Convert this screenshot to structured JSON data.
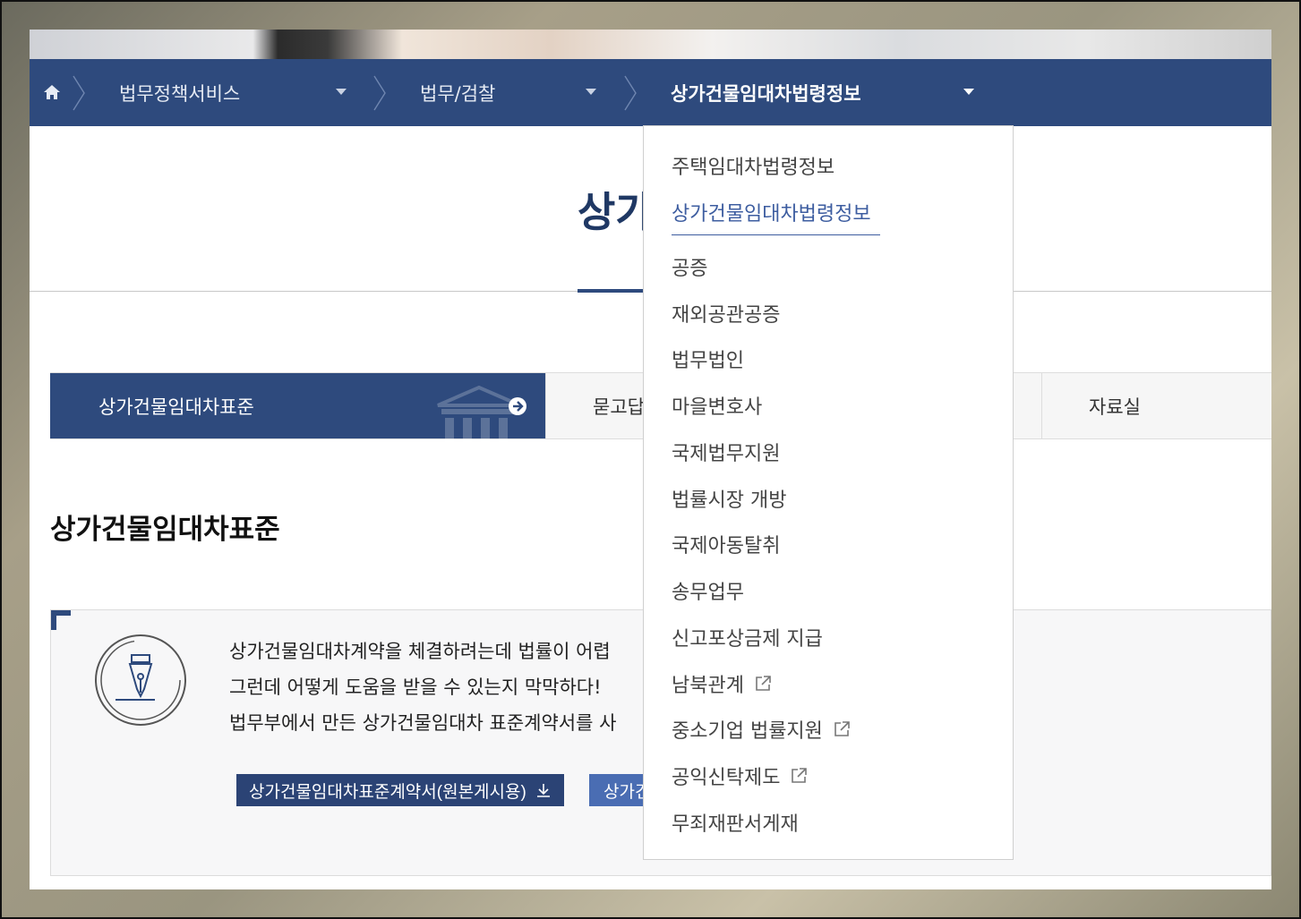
{
  "breadcrumb": {
    "home_icon": "home-icon",
    "level1": "법무정책서비스",
    "level2": "법무/검찰",
    "level3": "상가건물임대차법령정보"
  },
  "page": {
    "title": "상가"
  },
  "tabs": [
    {
      "label": "상가건물임대차표준",
      "active": true
    },
    {
      "label": "묻고답",
      "active": false
    },
    {
      "label": "",
      "active": false
    },
    {
      "label": "자료실",
      "active": false
    }
  ],
  "section": {
    "title": "상가건물임대차표준"
  },
  "info": {
    "line1": "상가건물임대차계약을 체결하려는데 법률이 어렵",
    "line2": "그런데 어떻게 도움을 받을 수 있는지 막막하다!",
    "line3": "법무부에서 만든 상가건물임대차 표준계약서를 사",
    "download_button": "상가건물임대차표준계약서(원본게시용)",
    "second_button": "상가건"
  },
  "dropdown": {
    "items": [
      {
        "label": "주택임대차법령정보",
        "external": false
      },
      {
        "label": "상가건물임대차법령정보",
        "external": false,
        "selected": true
      },
      {
        "label": "공증",
        "external": false
      },
      {
        "label": "재외공관공증",
        "external": false
      },
      {
        "label": "법무법인",
        "external": false
      },
      {
        "label": "마을변호사",
        "external": false
      },
      {
        "label": "국제법무지원",
        "external": false
      },
      {
        "label": "법률시장 개방",
        "external": false
      },
      {
        "label": "국제아동탈취",
        "external": false
      },
      {
        "label": "송무업무",
        "external": false
      },
      {
        "label": "신고포상금제 지급",
        "external": false
      },
      {
        "label": "남북관계",
        "external": true
      },
      {
        "label": "중소기업 법률지원",
        "external": true
      },
      {
        "label": "공익신탁제도",
        "external": true
      },
      {
        "label": "무죄재판서게재",
        "external": false
      }
    ]
  },
  "colors": {
    "navbar": "#2e4a7d",
    "accent": "#3d5da0",
    "button_dark": "#2b4375",
    "button_light": "#4a6db3"
  }
}
